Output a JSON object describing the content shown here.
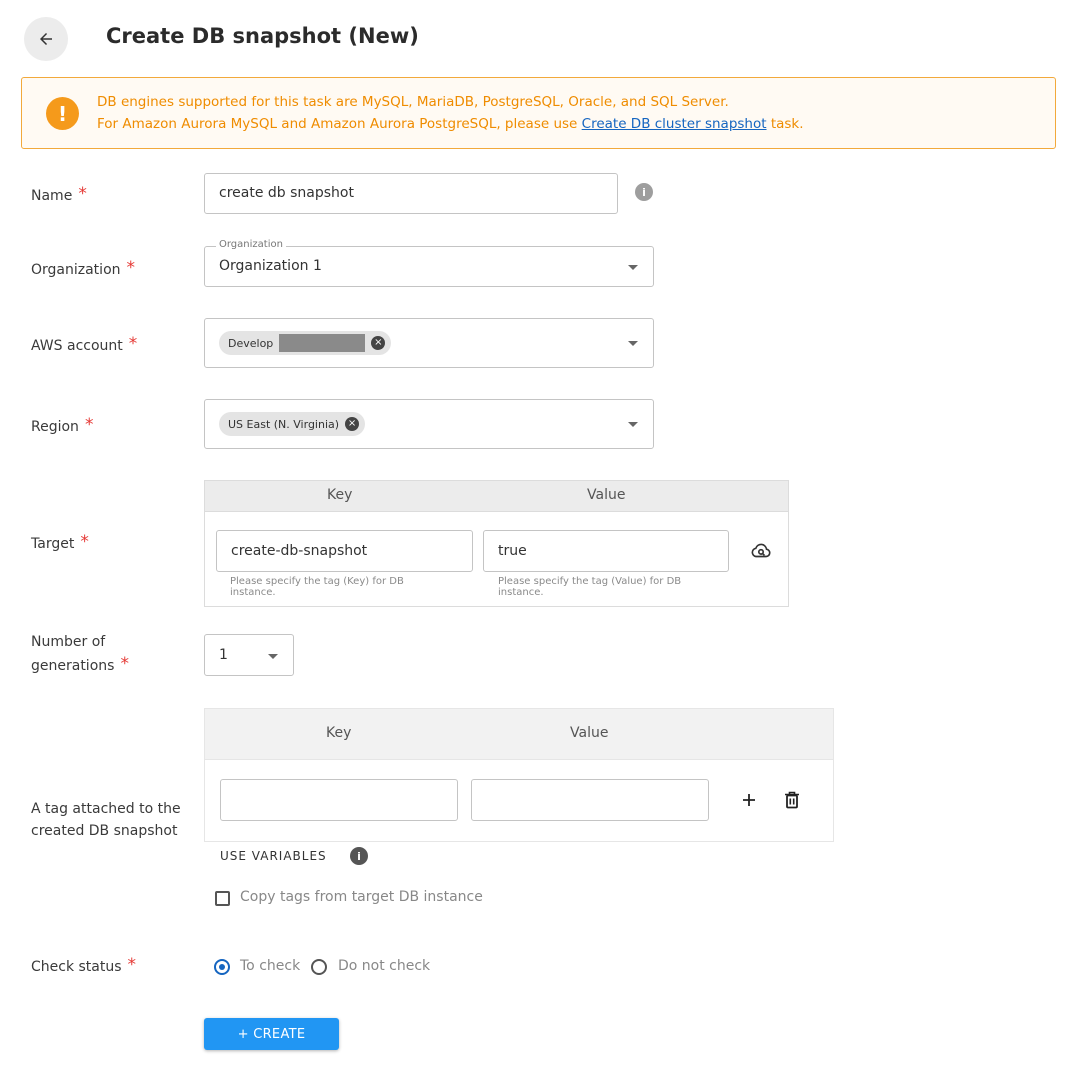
{
  "header": {
    "title": "Create DB snapshot (New)"
  },
  "alert": {
    "line1": "DB engines supported for this task are MySQL, MariaDB, PostgreSQL, Oracle, and SQL Server.",
    "line2_prefix": "For Amazon Aurora MySQL and Amazon Aurora PostgreSQL, please use ",
    "line2_link": "Create DB cluster snapshot",
    "line2_suffix": " task."
  },
  "form": {
    "name": {
      "label": "Name",
      "value": "create db snapshot"
    },
    "organization": {
      "label": "Organization",
      "legend": "Organization",
      "value": "Organization 1"
    },
    "aws_account": {
      "label": "AWS account",
      "chip": "Develop"
    },
    "region": {
      "label": "Region",
      "chip": "US East (N. Virginia)"
    },
    "target": {
      "label": "Target",
      "key_header": "Key",
      "value_header": "Value",
      "key": "create-db-snapshot",
      "value": "true",
      "key_hint": "Please specify the tag (Key) for DB instance.",
      "value_hint": "Please specify the tag (Value) for DB instance."
    },
    "generations": {
      "label_line1": "Number of",
      "label_line2": "generations",
      "value": "1"
    },
    "tags": {
      "label_line1": "A tag attached to the",
      "label_line2": "created DB snapshot",
      "key_header": "Key",
      "value_header": "Value",
      "key": "",
      "value": "",
      "use_variables": "USE VARIABLES",
      "copy_label": "Copy tags from target DB instance"
    },
    "check_status": {
      "label": "Check status",
      "option_check": "To check",
      "option_nocheck": "Do not check",
      "selected": "To check"
    },
    "required_mark": "*"
  },
  "actions": {
    "create": "+ CREATE"
  }
}
